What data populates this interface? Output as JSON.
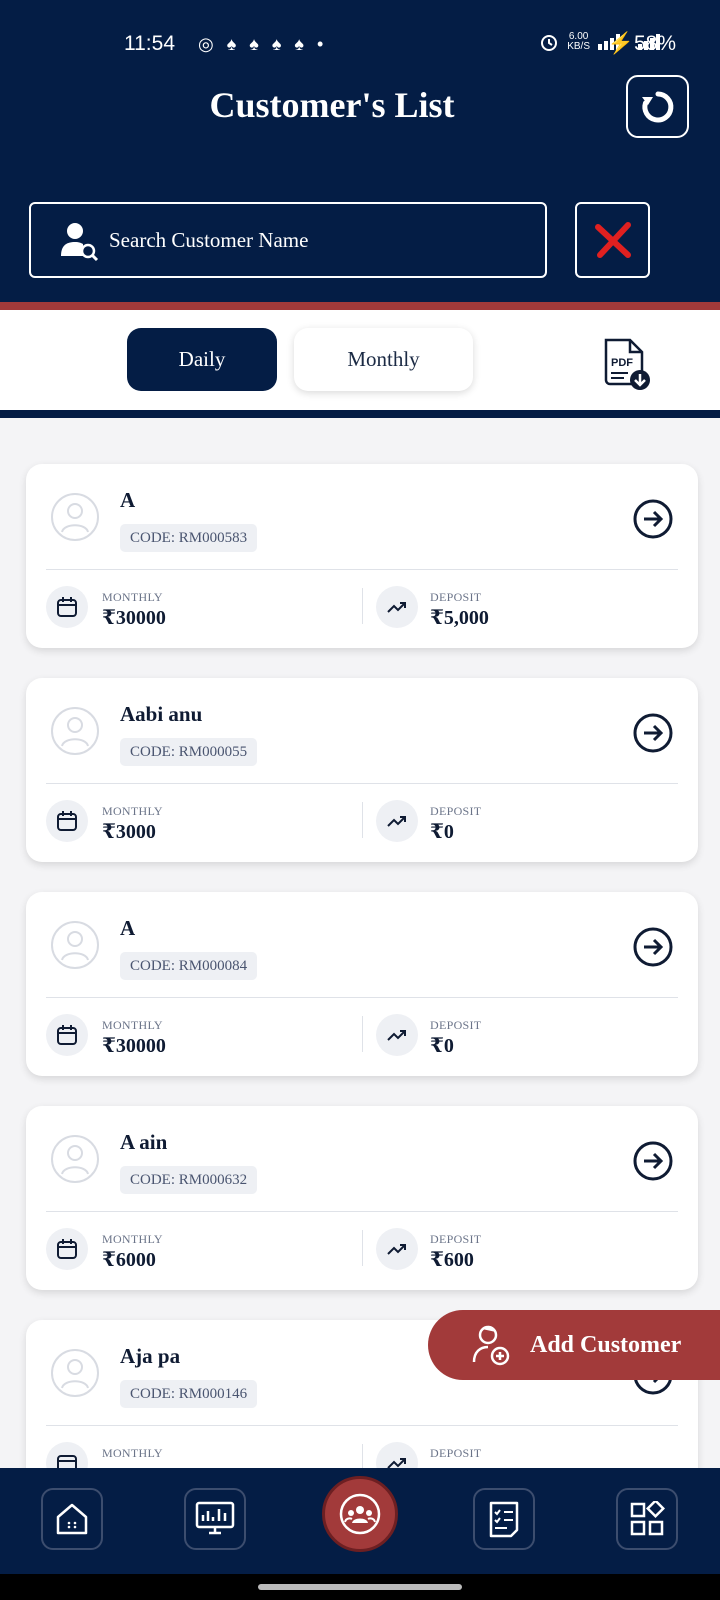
{
  "status_bar": {
    "time": "11:54",
    "notifications": "◎ ♠ ♠ ♠ ♠ •",
    "network_speed": "6.00",
    "network_unit": "KB/S",
    "battery": "58%"
  },
  "header": {
    "title": "Customer's List",
    "refresh_icon": "refresh-icon"
  },
  "search": {
    "placeholder": "Search Customer Name",
    "value": "",
    "icon": "search-user-icon",
    "clear_icon": "close-icon"
  },
  "tabs": [
    {
      "label": "Daily",
      "active": true
    },
    {
      "label": "Monthly",
      "active": false
    }
  ],
  "pdf_button": {
    "icon": "pdf-download-icon",
    "icon_text": "PDF"
  },
  "customers": [
    {
      "name": "A",
      "code": "CODE: RM000583",
      "monthly_label": "MONTHLY",
      "monthly_value": "₹30000",
      "deposit_label": "DEPOSIT",
      "deposit_value": "₹5,000"
    },
    {
      "name": "Aabi anu",
      "code": "CODE: RM000055",
      "monthly_label": "MONTHLY",
      "monthly_value": "₹3000",
      "deposit_label": "DEPOSIT",
      "deposit_value": "₹0"
    },
    {
      "name": "A",
      "code": "CODE: RM000084",
      "monthly_label": "MONTHLY",
      "monthly_value": "₹30000",
      "deposit_label": "DEPOSIT",
      "deposit_value": "₹0"
    },
    {
      "name": "A ain",
      "code": "CODE: RM000632",
      "monthly_label": "MONTHLY",
      "monthly_value": "₹6000",
      "deposit_label": "DEPOSIT",
      "deposit_value": "₹600"
    },
    {
      "name": "Aja pa",
      "code": "CODE: RM000146",
      "monthly_label": "MONTHLY",
      "monthly_value": "",
      "deposit_label": "DEPOSIT",
      "deposit_value": ""
    }
  ],
  "fab": {
    "label": "Add Customer",
    "icon": "add-user-icon"
  },
  "bottom_nav": [
    {
      "name": "home",
      "icon": "home-icon"
    },
    {
      "name": "dashboard",
      "icon": "monitor-chart-icon"
    },
    {
      "name": "customers",
      "icon": "customers-group-icon",
      "active": true
    },
    {
      "name": "reports",
      "icon": "checklist-icon"
    },
    {
      "name": "more",
      "icon": "apps-grid-icon"
    }
  ],
  "colors": {
    "primary": "#041d45",
    "accent": "#a23a3a",
    "background": "#f4f4f6"
  }
}
